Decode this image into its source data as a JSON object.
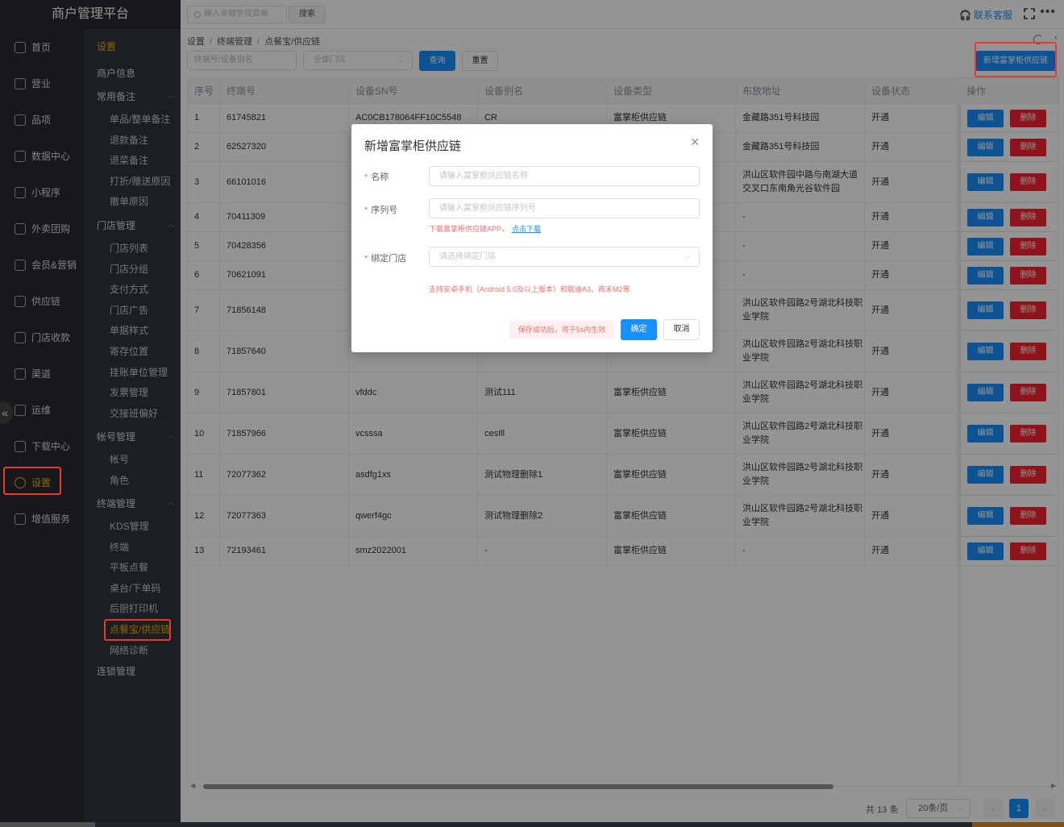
{
  "app": {
    "title": "商户管理平台"
  },
  "topbar": {
    "search_placeholder": "输入关键字找菜单",
    "search_button": "搜索",
    "contact": "联系客服"
  },
  "nav": [
    {
      "label": "首页",
      "icon": "home-icon"
    },
    {
      "label": "营业",
      "icon": "calendar-icon"
    },
    {
      "label": "品项",
      "icon": "bag-icon"
    },
    {
      "label": "数据中心",
      "icon": "share-icon"
    },
    {
      "label": "小程序",
      "icon": "phone-icon"
    },
    {
      "label": "外卖团购",
      "icon": "bike-icon"
    },
    {
      "label": "会员&营销",
      "icon": "user-icon"
    },
    {
      "label": "供应链",
      "icon": "truck-icon"
    },
    {
      "label": "门店收款",
      "icon": "database-icon"
    },
    {
      "label": "渠道",
      "icon": "crop-icon"
    },
    {
      "label": "运维",
      "icon": "tools-icon"
    },
    {
      "label": "下载中心",
      "icon": "download-icon"
    },
    {
      "label": "设置",
      "icon": "gear-icon"
    },
    {
      "label": "增值服务",
      "icon": "clock-icon"
    }
  ],
  "subnav": {
    "title": "设置",
    "merchant_info": "商户信息",
    "groups": [
      {
        "label": "常用备注",
        "items": [
          "单品/整单备注",
          "退款备注",
          "退菜备注",
          "打折/赠送原因",
          "撤单原因"
        ]
      },
      {
        "label": "门店管理",
        "items": [
          "门店列表",
          "门店分组",
          "支付方式",
          "门店广告",
          "单据样式",
          "寄存位置",
          "挂账单位管理",
          "发票管理",
          "交接班偏好"
        ]
      },
      {
        "label": "帐号管理",
        "items": [
          "帐号",
          "角色"
        ]
      },
      {
        "label": "终端管理",
        "items": [
          "KDS管理",
          "终端",
          "平板点餐",
          "桌台/下单码",
          "后厨打印机",
          "点餐宝/供应链",
          "网络诊断"
        ]
      }
    ],
    "chain": "连锁管理"
  },
  "breadcrumb": [
    "设置",
    "终端管理",
    "点餐宝/供应链"
  ],
  "filters": {
    "device_placeholder": "终端号/设备别名",
    "store_placeholder": "全部门店",
    "query": "查询",
    "reset": "重置",
    "add": "新增富掌柜供应链"
  },
  "table": {
    "headers": [
      "序号",
      "终端号",
      "设备SN号",
      "设备别名",
      "设备类型",
      "布放地址",
      "设备状态",
      "操作"
    ],
    "edit": "编辑",
    "delete": "删除",
    "rows": [
      [
        "1",
        "61745821",
        "AC0CB178064FF10C5548",
        "CR",
        "富掌柜供应链",
        "金藏路351号科技园",
        "开通"
      ],
      [
        "2",
        "62527320",
        "",
        "",
        "",
        "金藏路351号科技园",
        "开通"
      ],
      [
        "3",
        "66101016",
        "",
        "",
        "",
        "洪山区软件园中路与南湖大道交叉口东南角光谷软件园",
        "开通"
      ],
      [
        "4",
        "70411309",
        "",
        "",
        "",
        "-",
        "开通"
      ],
      [
        "5",
        "70428356",
        "",
        "",
        "",
        "-",
        "开通"
      ],
      [
        "6",
        "70621091",
        "",
        "",
        "",
        "-",
        "开通"
      ],
      [
        "7",
        "71856148",
        "",
        "",
        "",
        "洪山区软件园路2号湖北科技职业学院",
        "开通"
      ],
      [
        "8",
        "71857640",
        "",
        "",
        "",
        "洪山区软件园路2号湖北科技职业学院",
        "开通"
      ],
      [
        "9",
        "71857801",
        "vfddc",
        "测试111",
        "富掌柜供应链",
        "洪山区软件园路2号湖北科技职业学院",
        "开通"
      ],
      [
        "10",
        "71857966",
        "vcsssa",
        "cesIll",
        "富掌柜供应链",
        "洪山区软件园路2号湖北科技职业学院",
        "开通"
      ],
      [
        "11",
        "72077362",
        "asdfg1xs",
        "测试物理删除1",
        "富掌柜供应链",
        "洪山区软件园路2号湖北科技职业学院",
        "开通"
      ],
      [
        "12",
        "72077363",
        "qwerf4gc",
        "测试物理删除2",
        "富掌柜供应链",
        "洪山区软件园路2号湖北科技职业学院",
        "开通"
      ],
      [
        "13",
        "72193461",
        "smz2022001",
        "-",
        "富掌柜供应链",
        "-",
        "开通"
      ]
    ]
  },
  "pagination": {
    "total": "共 13 条",
    "page_size": "20条/页",
    "current": "1"
  },
  "modal": {
    "title": "新增富掌柜供应链",
    "name_label": "名称",
    "name_placeholder": "请输入富掌柜供应链名称",
    "serial_label": "序列号",
    "serial_placeholder": "请输入富掌柜供应链序列号",
    "download_hint": "下载富掌柜供应链APP，",
    "download_link": "点击下载",
    "store_label": "绑定门店",
    "store_placeholder": "请选择绑定门店",
    "support_hint": "支持安卓手机（Android 5.0及以上版本）和联迪A3、商米M2等",
    "save_hint": "保存成功后，将于5s内生效",
    "confirm": "确定",
    "cancel": "取消"
  }
}
